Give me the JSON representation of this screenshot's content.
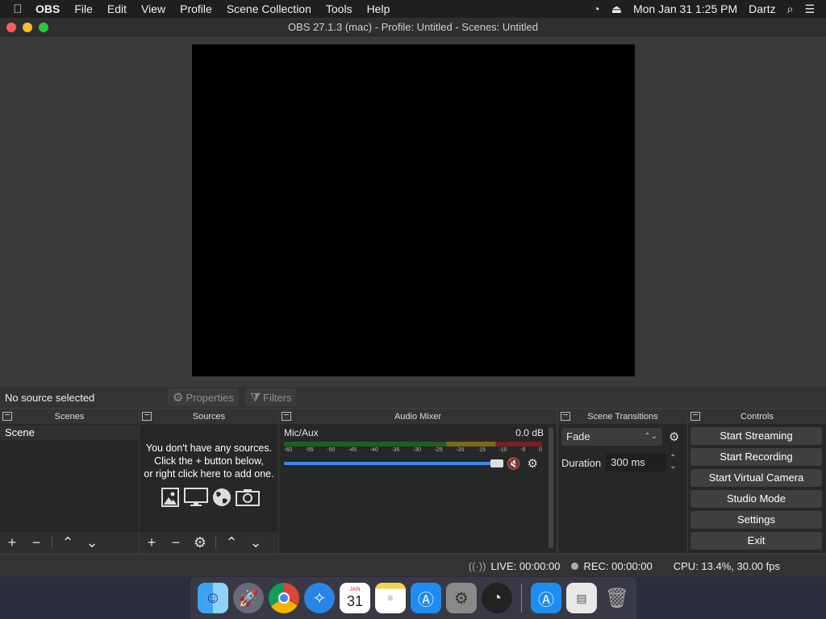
{
  "menubar": {
    "app_name": "OBS",
    "items": [
      "File",
      "Edit",
      "View",
      "Profile",
      "Scene Collection",
      "Tools",
      "Help"
    ],
    "clock": "Mon Jan 31  1:25 PM",
    "user": "Dartz"
  },
  "window": {
    "title": "OBS 27.1.3 (mac) - Profile: Untitled - Scenes: Untitled"
  },
  "source_toolbar": {
    "status": "No source selected",
    "properties_label": "Properties",
    "filters_label": "Filters"
  },
  "scenes": {
    "header": "Scenes",
    "items": [
      "Scene"
    ]
  },
  "sources": {
    "header": "Sources",
    "empty_line1": "You don't have any sources.",
    "empty_line2": "Click the + button below,",
    "empty_line3": "or right click here to add one."
  },
  "mixer": {
    "header": "Audio Mixer",
    "channel_name": "Mic/Aux",
    "channel_db": "0.0 dB",
    "ticks": [
      "-60",
      "-55",
      "-50",
      "-45",
      "-40",
      "-35",
      "-30",
      "-25",
      "-20",
      "-15",
      "-10",
      "-5",
      "0"
    ]
  },
  "transitions": {
    "header": "Scene Transitions",
    "selected": "Fade",
    "duration_label": "Duration",
    "duration_value": "300 ms"
  },
  "controls": {
    "header": "Controls",
    "buttons": [
      "Start Streaming",
      "Start Recording",
      "Start Virtual Camera",
      "Studio Mode",
      "Settings",
      "Exit"
    ]
  },
  "statusbar": {
    "live": "LIVE: 00:00:00",
    "rec": "REC: 00:00:00",
    "cpu": "CPU: 13.4%, 30.00 fps"
  },
  "dock": {
    "calendar_month": "JAN",
    "calendar_day": "31"
  },
  "colors": {
    "menubar": "#1f1f20",
    "window": "#3a3a3a",
    "panel": "#272727",
    "accent": "#3d8af7",
    "mute": "#ee3333"
  }
}
